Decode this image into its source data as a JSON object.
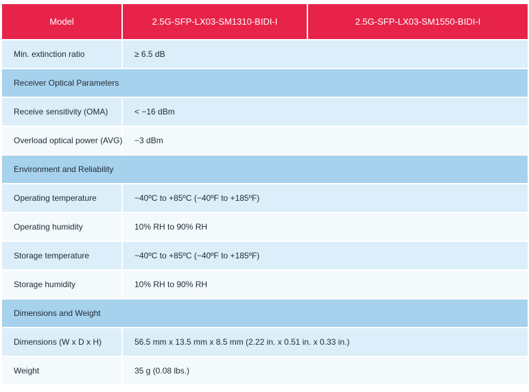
{
  "header": {
    "model_label": "Model",
    "model_1": "2.5G-SFP-LX03-SM1310-BIDI-I",
    "model_2": "2.5G-SFP-LX03-SM1550-BIDI-I"
  },
  "rows": [
    {
      "label": "Min. extinction ratio",
      "value": "≥ 6.5 dB"
    },
    {
      "section": "Receiver Optical Parameters"
    },
    {
      "label": "Receive sensitivity (OMA)",
      "value": "< −16 dBm"
    },
    {
      "label": "Overload optical power (AVG)",
      "value": "−3 dBm"
    },
    {
      "section": "Environment and Reliability"
    },
    {
      "label": "Operating temperature",
      "value": "−40ºC to +85ºC (−40ºF to +185ºF)"
    },
    {
      "label": "Operating humidity",
      "value": "10% RH to 90% RH"
    },
    {
      "label": "Storage temperature",
      "value": "−40ºC to +85ºC (−40ºF to +185ºF)"
    },
    {
      "label": "Storage humidity",
      "value": "10% RH to 90% RH"
    },
    {
      "section": "Dimensions and Weight"
    },
    {
      "label": "Dimensions (W x D x H)",
      "value": "56.5 mm x 13.5 mm x 8.5 mm (2.22 in. x 0.51 in. x 0.33 in.)"
    },
    {
      "label": "Weight",
      "value": "35 g (0.08 lbs.)"
    }
  ],
  "colors": {
    "header": "#e8234a",
    "section": "#a7d2ee",
    "row_light": "#dbeef9",
    "row_white": "#f4f9fc"
  }
}
